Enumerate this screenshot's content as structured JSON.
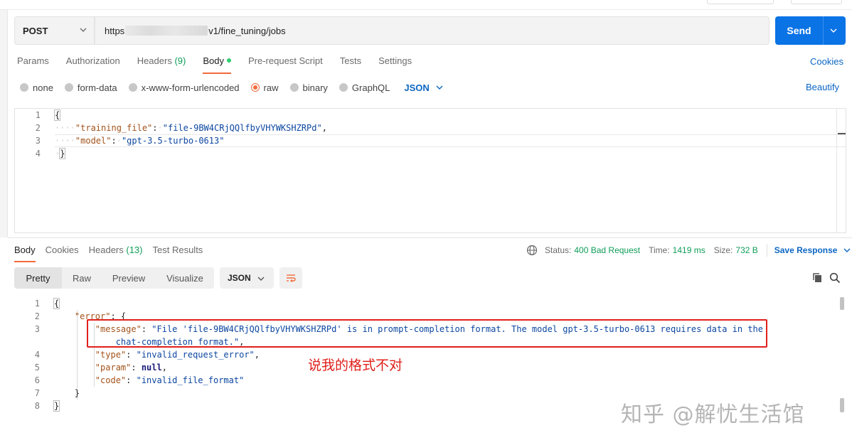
{
  "request": {
    "method": "POST",
    "url_prefix": "https",
    "url_suffix": "v1/fine_tuning/jobs",
    "send_label": "Send"
  },
  "request_tabs": [
    {
      "label": "Params"
    },
    {
      "label": "Authorization"
    },
    {
      "label": "Headers",
      "count": "(9)"
    },
    {
      "label": "Body"
    },
    {
      "label": "Pre-request Script"
    },
    {
      "label": "Tests"
    },
    {
      "label": "Settings"
    }
  ],
  "cookies_label": "Cookies",
  "body_types": [
    "none",
    "form-data",
    "x-www-form-urlencoded",
    "raw",
    "binary",
    "GraphQL"
  ],
  "body_format": "JSON",
  "beautify_label": "Beautify",
  "request_body": {
    "line_numbers": [
      "1",
      "2",
      "3",
      "4"
    ],
    "open_brace": "{",
    "close_brace": "}",
    "training_file_key": "\"training_file\"",
    "training_file_value": "\"file-9BW4CRjQQlfbyVHYWKSHZRPd\"",
    "model_key": "\"model\"",
    "model_value": "\"gpt-3.5-turbo-0613\""
  },
  "response_tabs": [
    {
      "label": "Body"
    },
    {
      "label": "Cookies"
    },
    {
      "label": "Headers",
      "count": "(13)"
    },
    {
      "label": "Test Results"
    }
  ],
  "status": {
    "status_label": "Status:",
    "status_value": "400 Bad Request",
    "time_label": "Time:",
    "time_value": "1419 ms",
    "size_label": "Size:",
    "size_value": "732 B",
    "save_response_label": "Save Response"
  },
  "view_modes": [
    "Pretty",
    "Raw",
    "Preview",
    "Visualize"
  ],
  "response_format": "JSON",
  "response_body": {
    "line_numbers": [
      "1",
      "2",
      "3",
      "",
      "4",
      "5",
      "6",
      "7",
      "8"
    ],
    "open_brace": "{",
    "error_key": "\"error\"",
    "message_key": "\"message\"",
    "message_value_line1": "\"File 'file-9BW4CRjQQlfbyVHYWKSHZRPd' is in prompt-completion format. The model gpt-3.5-turbo-0613 requires data in the",
    "message_value_line2": "chat-completion format.\"",
    "type_key": "\"type\"",
    "type_value": "\"invalid_request_error\"",
    "param_key": "\"param\"",
    "param_value": "null",
    "code_key": "\"code\"",
    "code_value": "\"invalid_file_format\"",
    "close_inner": "}",
    "close_brace": "}"
  },
  "annotation_text": "说我的格式不对",
  "watermark_text": "知乎 @解忧生活馆",
  "colors": {
    "accent_orange": "#f26b3a",
    "send_blue": "#0a73e5",
    "status_green": "#0f9d58",
    "annotation_red": "#e0201b"
  }
}
